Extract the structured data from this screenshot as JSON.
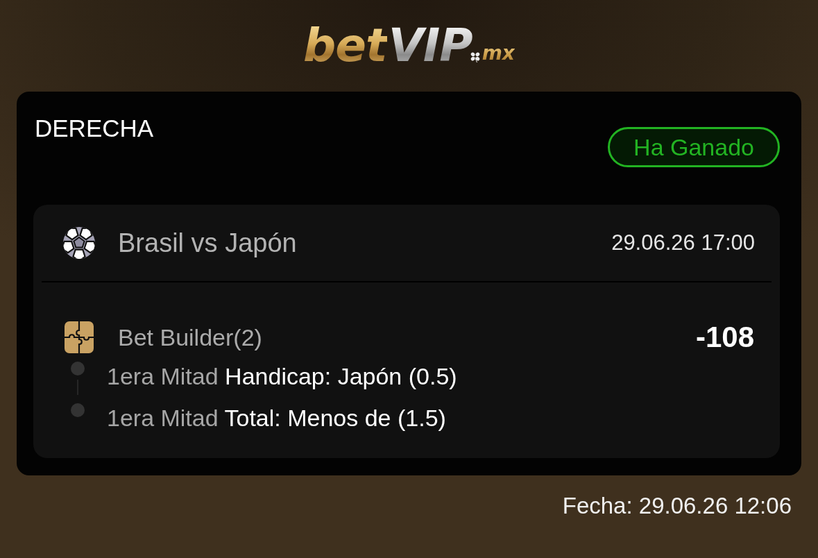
{
  "logo": {
    "prefix": "bet",
    "main": "VIP",
    "suffix": "mx"
  },
  "ticket": {
    "title": "DERECHA",
    "status": {
      "label": "Ha Ganado",
      "kind": "won"
    },
    "event": {
      "name": "Brasil vs Japón",
      "datetime": "29.06.26 17:00"
    },
    "bet": {
      "type": "Bet Builder(2)",
      "odds": "-108",
      "selections": [
        {
          "period": "1era Mitad",
          "market": "Handicap: Japón (0.5)"
        },
        {
          "period": "1era Mitad",
          "market": "Total: Menos de (1.5)"
        }
      ]
    }
  },
  "footer": {
    "date": "Fecha: 29.06.26 12:06"
  }
}
